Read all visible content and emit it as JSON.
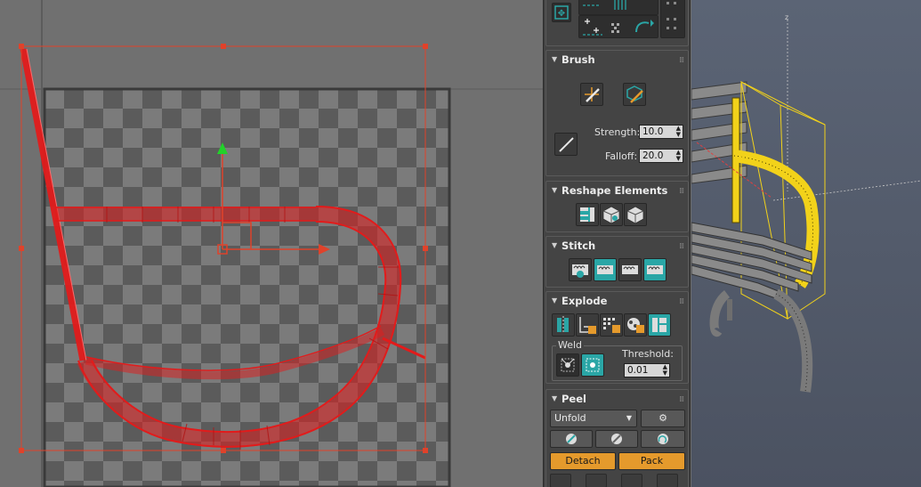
{
  "uv_editor": {
    "checker_colors": [
      "#5a5a5a",
      "#7c7c7c"
    ],
    "selection_color": "#e0422a",
    "uv_color": "#e21b1b"
  },
  "panel": {
    "rollouts": {
      "brush": {
        "title": "Brush",
        "icons": [
          "move-brush-icon",
          "relax-brush-icon",
          "line-brush-icon"
        ],
        "strength_label": "Strength:",
        "strength_value": "10.0",
        "falloff_label": "Falloff:",
        "falloff_value": "20.0"
      },
      "reshape": {
        "title": "Reshape Elements",
        "icons": [
          "straighten-icon",
          "relax-icon",
          "flatten-icon"
        ]
      },
      "stitch": {
        "title": "Stitch",
        "icons": [
          "stitch-custom-icon",
          "stitch-source-icon",
          "stitch-average-icon",
          "stitch-target-icon"
        ]
      },
      "explode": {
        "title": "Explode",
        "icons": [
          "break-icon",
          "flatten-by-smoothing-icon",
          "flatten-by-polygon-icon",
          "flatten-by-material-icon",
          "explode-to-islands-icon"
        ],
        "weld_title": "Weld",
        "weld_icons": [
          "weld-selected-icon",
          "weld-all-icon"
        ],
        "threshold_label": "Threshold:",
        "threshold_value": "0.01"
      },
      "peel": {
        "title": "Peel",
        "mode_value": "Unfold",
        "detach_label": "Detach",
        "pack_label": "Pack"
      }
    },
    "accent_orange": "#e59a2c",
    "accent_teal": "#2aa6a6"
  },
  "viewport3d": {
    "gizmo_label": "z",
    "background_top": "#5b6475",
    "selection_color": "#f2d21a"
  }
}
